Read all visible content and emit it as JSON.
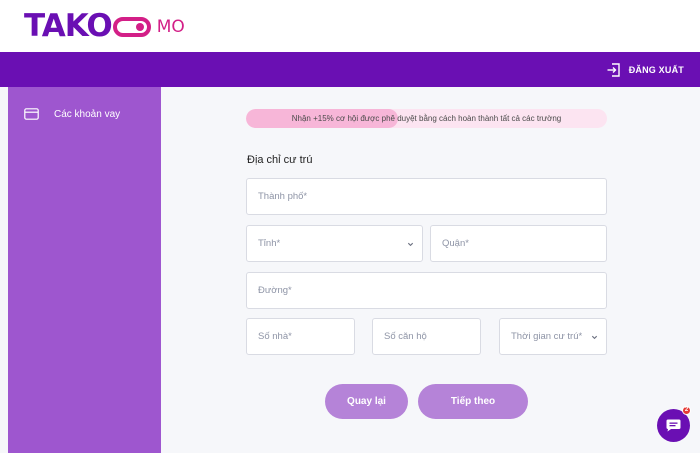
{
  "brand": {
    "logo_text": "TAKO",
    "logo_suffix": "MO",
    "primary_color": "#6a0fb3",
    "accent_color": "#d31f87",
    "sidebar_color": "#9e56cf",
    "button_color": "#b583d8"
  },
  "header": {
    "logout_label": "ĐĂNG XUẤT",
    "logout_icon": "logout-icon"
  },
  "sidebar": {
    "items": [
      {
        "label": "Các khoản vay",
        "icon": "credit-card-icon"
      }
    ]
  },
  "progress": {
    "text": "Nhận +15% cơ hội được phê duyệt bằng cách hoàn thành tất cả các trường",
    "fraction": 0.42
  },
  "form": {
    "title": "Địa chỉ cư trú",
    "fields": {
      "city": "Thành phố*",
      "province": "Tỉnh*",
      "district": "Quận*",
      "street": "Đường*",
      "house_number": "Số nhà*",
      "apartment_number": "Số căn hộ",
      "residence_time": "Thời gian cư trú*"
    }
  },
  "actions": {
    "back_label": "Quay lại",
    "next_label": "Tiếp theo"
  },
  "chat": {
    "icon": "chat-icon",
    "badge": "2"
  }
}
